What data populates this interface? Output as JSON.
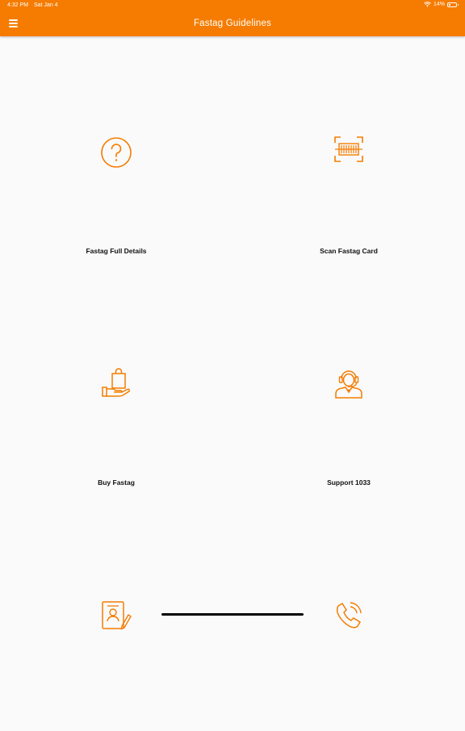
{
  "status_bar": {
    "time": "4:32 PM",
    "date": "Sat Jan 4",
    "battery": "14%"
  },
  "header": {
    "title": "Fastag Guidelines",
    "menu_icon": "hamburger-menu-icon"
  },
  "colors": {
    "accent": "#f57c00",
    "background": "#fafafa",
    "label": "#111111"
  },
  "tiles": [
    {
      "label": "Fastag Full Details",
      "icon": "question-circle-icon"
    },
    {
      "label": "Scan Fastag Card",
      "icon": "barcode-scan-icon"
    },
    {
      "label": "Buy Fastag",
      "icon": "shopping-bag-hand-icon"
    },
    {
      "label": "Support 1033",
      "icon": "support-agent-icon"
    },
    {
      "label": "",
      "icon": "document-profile-icon"
    },
    {
      "label": "",
      "icon": "phone-call-icon"
    }
  ]
}
